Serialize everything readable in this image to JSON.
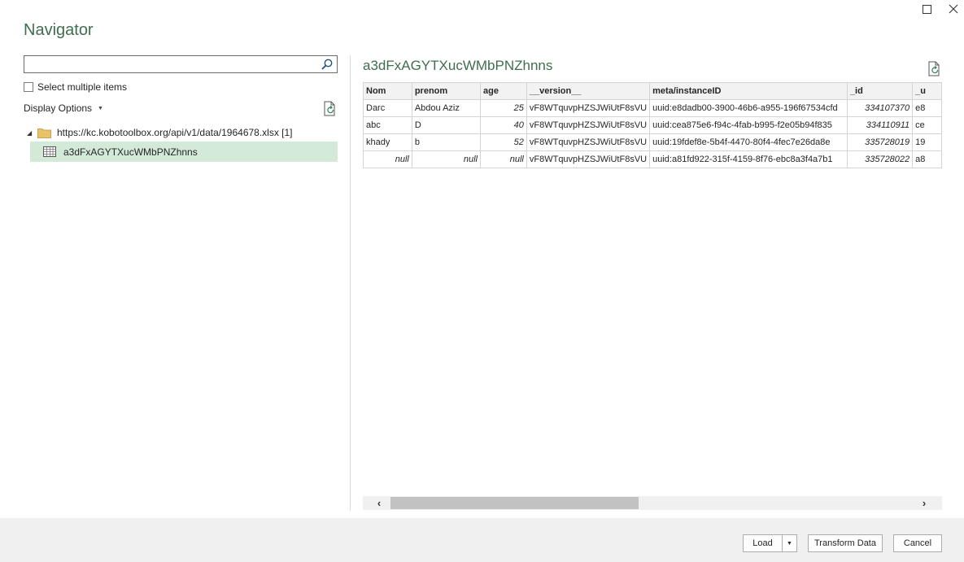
{
  "window": {
    "title": "Navigator",
    "controls": [
      "maximize-icon",
      "close-icon"
    ]
  },
  "left": {
    "search": {
      "value": "",
      "placeholder": ""
    },
    "select_multiple_label": "Select multiple items",
    "display_options_label": "Display Options",
    "tree": {
      "folder_label": "https://kc.kobotoolbox.org/api/v1/data/1964678.xlsx [1]",
      "item_label": "a3dFxAGYTXucWMbPNZhnns"
    }
  },
  "preview": {
    "title": "a3dFxAGYTXucWMbPNZhnns",
    "columns": [
      "Nom",
      "prenom",
      "age",
      "__version__",
      "meta/instanceID",
      "_id",
      "_u"
    ],
    "rows": [
      [
        "Darc",
        "Abdou Aziz",
        "25",
        "vF8WTquvpHZSJWiUtF8sVU",
        "uuid:e8dadb00-3900-46b6-a955-196f67534cfd",
        "334107370",
        "e8"
      ],
      [
        "abc",
        "D",
        "40",
        "vF8WTquvpHZSJWiUtF8sVU",
        "uuid:cea875e6-f94c-4fab-b995-f2e05b94f835",
        "334110911",
        "ce"
      ],
      [
        "khady",
        "b",
        "52",
        "vF8WTquvpHZSJWiUtF8sVU",
        "uuid:19fdef8e-5b4f-4470-80f4-4fec7e26da8e",
        "335728019",
        "19"
      ],
      [
        "null",
        "null",
        "null",
        "vF8WTquvpHZSJWiUtF8sVU",
        "uuid:a81fd922-315f-4159-8f76-ebc8a3f4a7b1",
        "335728022",
        "a8"
      ]
    ]
  },
  "footer": {
    "load_label": "Load",
    "transform_label": "Transform Data",
    "cancel_label": "Cancel"
  },
  "colors": {
    "accent_green": "#3f6e4d",
    "selection": "#d3ead9"
  }
}
